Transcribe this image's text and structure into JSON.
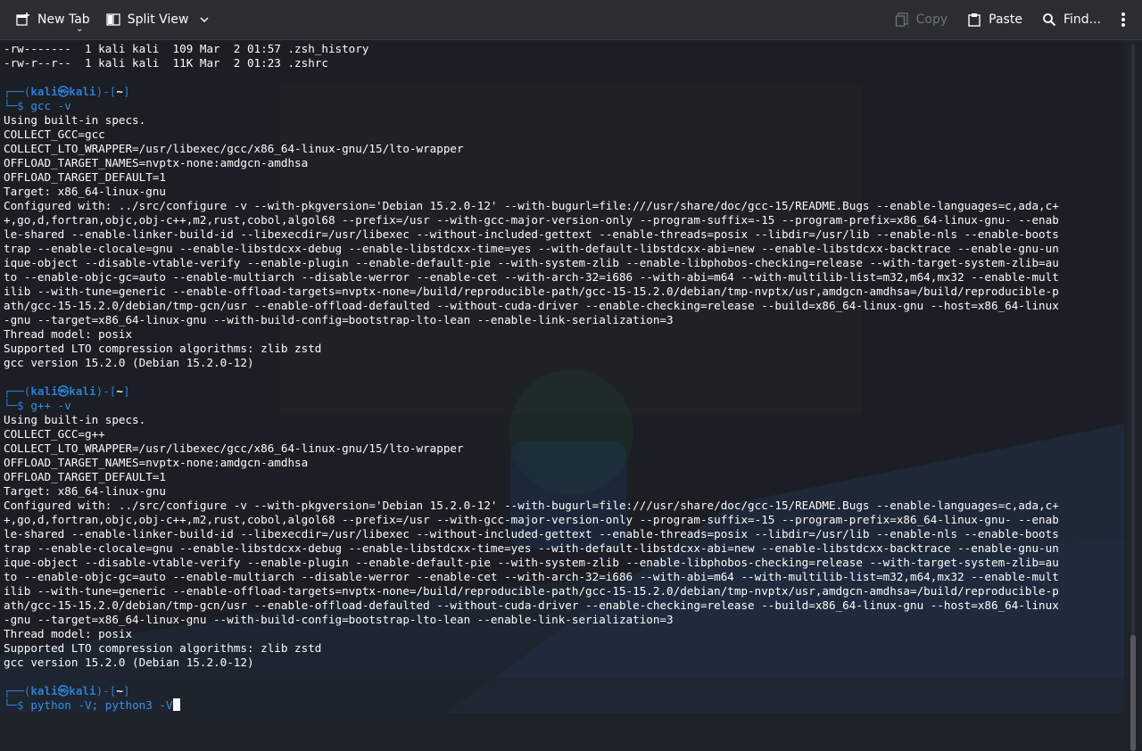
{
  "toolbar": {
    "new_tab_label": "New Tab",
    "split_view_label": "Split View",
    "copy_label": "Copy",
    "paste_label": "Paste",
    "find_label": "Find..."
  },
  "terminal": {
    "listing": [
      "-rw-------  1 kali kali  109 Mar  2 01:57 .zsh_history",
      "-rw-r--r--  1 kali kali  11K Mar  2 01:23 .zshrc"
    ],
    "prompt": {
      "top_prefix": "┌──(",
      "user": "kali㉿kali",
      "mid": ")-[",
      "dir": "~",
      "end": "]",
      "bottom_prefix": "└─$ "
    },
    "blocks": [
      {
        "command": "gcc -v",
        "output": [
          "Using built-in specs.",
          "COLLECT_GCC=gcc",
          "COLLECT_LTO_WRAPPER=/usr/libexec/gcc/x86_64-linux-gnu/15/lto-wrapper",
          "OFFLOAD_TARGET_NAMES=nvptx-none:amdgcn-amdhsa",
          "OFFLOAD_TARGET_DEFAULT=1",
          "Target: x86_64-linux-gnu",
          "Configured with: ../src/configure -v --with-pkgversion='Debian 15.2.0-12' --with-bugurl=file:///usr/share/doc/gcc-15/README.Bugs --enable-languages=c,ada,c+",
          "+,go,d,fortran,objc,obj-c++,m2,rust,cobol,algol68 --prefix=/usr --with-gcc-major-version-only --program-suffix=-15 --program-prefix=x86_64-linux-gnu- --enab",
          "le-shared --enable-linker-build-id --libexecdir=/usr/libexec --without-included-gettext --enable-threads=posix --libdir=/usr/lib --enable-nls --enable-boots",
          "trap --enable-clocale=gnu --enable-libstdcxx-debug --enable-libstdcxx-time=yes --with-default-libstdcxx-abi=new --enable-libstdcxx-backtrace --enable-gnu-un",
          "ique-object --disable-vtable-verify --enable-plugin --enable-default-pie --with-system-zlib --enable-libphobos-checking=release --with-target-system-zlib=au",
          "to --enable-objc-gc=auto --enable-multiarch --disable-werror --enable-cet --with-arch-32=i686 --with-abi=m64 --with-multilib-list=m32,m64,mx32 --enable-mult",
          "ilib --with-tune=generic --enable-offload-targets=nvptx-none=/build/reproducible-path/gcc-15-15.2.0/debian/tmp-nvptx/usr,amdgcn-amdhsa=/build/reproducible-p",
          "ath/gcc-15-15.2.0/debian/tmp-gcn/usr --enable-offload-defaulted --without-cuda-driver --enable-checking=release --build=x86_64-linux-gnu --host=x86_64-linux",
          "-gnu --target=x86_64-linux-gnu --with-build-config=bootstrap-lto-lean --enable-link-serialization=3",
          "Thread model: posix",
          "Supported LTO compression algorithms: zlib zstd",
          "gcc version 15.2.0 (Debian 15.2.0-12)"
        ]
      },
      {
        "command": "g++ -v",
        "output": [
          "Using built-in specs.",
          "COLLECT_GCC=g++",
          "COLLECT_LTO_WRAPPER=/usr/libexec/gcc/x86_64-linux-gnu/15/lto-wrapper",
          "OFFLOAD_TARGET_NAMES=nvptx-none:amdgcn-amdhsa",
          "OFFLOAD_TARGET_DEFAULT=1",
          "Target: x86_64-linux-gnu",
          "Configured with: ../src/configure -v --with-pkgversion='Debian 15.2.0-12' --with-bugurl=file:///usr/share/doc/gcc-15/README.Bugs --enable-languages=c,ada,c+",
          "+,go,d,fortran,objc,obj-c++,m2,rust,cobol,algol68 --prefix=/usr --with-gcc-major-version-only --program-suffix=-15 --program-prefix=x86_64-linux-gnu- --enab",
          "le-shared --enable-linker-build-id --libexecdir=/usr/libexec --without-included-gettext --enable-threads=posix --libdir=/usr/lib --enable-nls --enable-boots",
          "trap --enable-clocale=gnu --enable-libstdcxx-debug --enable-libstdcxx-time=yes --with-default-libstdcxx-abi=new --enable-libstdcxx-backtrace --enable-gnu-un",
          "ique-object --disable-vtable-verify --enable-plugin --enable-default-pie --with-system-zlib --enable-libphobos-checking=release --with-target-system-zlib=au",
          "to --enable-objc-gc=auto --enable-multiarch --disable-werror --enable-cet --with-arch-32=i686 --with-abi=m64 --with-multilib-list=m32,m64,mx32 --enable-mult",
          "ilib --with-tune=generic --enable-offload-targets=nvptx-none=/build/reproducible-path/gcc-15-15.2.0/debian/tmp-nvptx/usr,amdgcn-amdhsa=/build/reproducible-p",
          "ath/gcc-15-15.2.0/debian/tmp-gcn/usr --enable-offload-defaulted --without-cuda-driver --enable-checking=release --build=x86_64-linux-gnu --host=x86_64-linux",
          "-gnu --target=x86_64-linux-gnu --with-build-config=bootstrap-lto-lean --enable-link-serialization=3",
          "Thread model: posix",
          "Supported LTO compression algorithms: zlib zstd",
          "gcc version 15.2.0 (Debian 15.2.0-12)"
        ]
      }
    ],
    "current_command": "python -V; python3 -V"
  },
  "colors": {
    "prompt_accent": "#2f7dd1",
    "terminal_bg": "#1b1e24",
    "toolbar_bg": "#2a2e32"
  }
}
